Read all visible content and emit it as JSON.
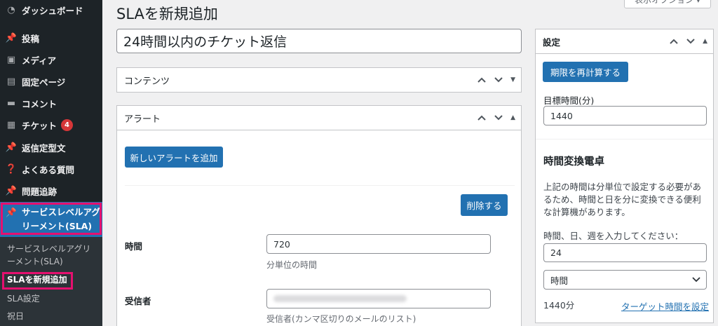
{
  "sidebar": {
    "items": [
      {
        "label": "ダッシュボード",
        "icon": "dashboard-icon"
      },
      {
        "label": "投稿",
        "icon": "pin-icon"
      },
      {
        "label": "メディア",
        "icon": "media-icon"
      },
      {
        "label": "固定ページ",
        "icon": "page-icon"
      },
      {
        "label": "コメント",
        "icon": "comment-icon"
      },
      {
        "label": "チケット",
        "icon": "grid-icon",
        "badge": "4"
      },
      {
        "label": "返信定型文",
        "icon": "pin-icon"
      },
      {
        "label": "よくある質問",
        "icon": "help-icon"
      },
      {
        "label": "問題追跡",
        "icon": "pin-icon"
      }
    ],
    "active": {
      "line1": "サービスレベルアグ",
      "line2": "リーメント(SLA)",
      "icon": "pin-icon"
    },
    "submenu": [
      {
        "line1": "サービスレベルアグリ",
        "line2": "ーメント(SLA)"
      },
      {
        "label": "SLAを新規追加"
      },
      {
        "label": "SLA設定"
      },
      {
        "label": "祝日"
      }
    ],
    "highlight_color": "#e5106f"
  },
  "header": {
    "title": "SLAを新規追加",
    "screen_options": "表示オプション ▾"
  },
  "post_title": "24時間以内のチケット返信",
  "contents_box": {
    "title": "コンテンツ"
  },
  "alert_box": {
    "title": "アラート",
    "add_button": "新しいアラートを追加",
    "delete_button": "削除する",
    "time_label": "時間",
    "time_value": "720",
    "time_desc": "分単位の時間",
    "recipient_label": "受信者",
    "recipient_desc": "受信者(カンマ区切りのメールのリスト)"
  },
  "settings_box": {
    "title": "設定",
    "recalc_button": "期限を再計算する",
    "target_label": "目標時間(分)",
    "target_value": "1440",
    "calc_title": "時間変換電卓",
    "calc_desc_1": "上記の時間は分単位で設定する必要があ",
    "calc_desc_2": "るため、時間と日を分に変換できる便利",
    "calc_desc_3": "な計算機があります。",
    "calc_input_label": "時間、日、週を入力してください：",
    "calc_input_value": "24",
    "unit_selected": "時間",
    "result": "1440分",
    "set_target_link": "ターゲット時間を設定"
  },
  "colors": {
    "accent": "#2271b1",
    "sidebar": "#1d2327",
    "badge": "#d63638"
  }
}
